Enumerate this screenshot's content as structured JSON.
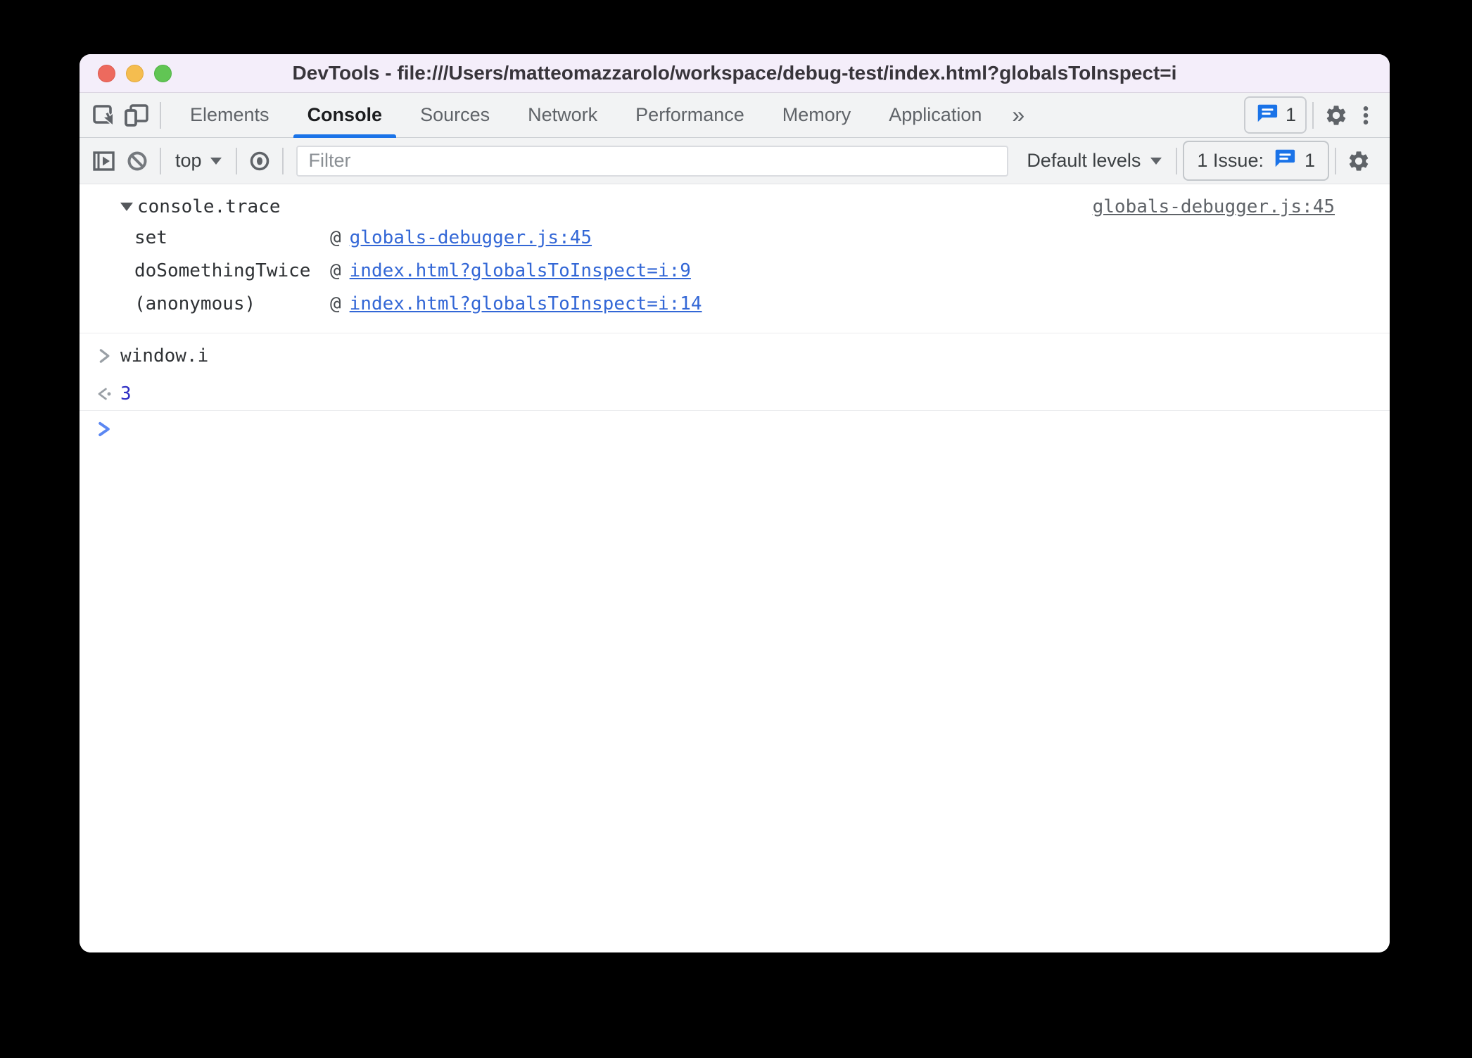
{
  "window_title": "DevTools - file:///Users/matteomazzarolo/workspace/debug-test/index.html?globalsToInspect=i",
  "tabbar": {
    "tabs": [
      "Elements",
      "Console",
      "Sources",
      "Network",
      "Performance",
      "Memory",
      "Application"
    ],
    "active_tab": "Console",
    "more_tabs": "»",
    "messages_count": "1"
  },
  "toolbar": {
    "context": "top",
    "filter_placeholder": "Filter",
    "filter_value": "",
    "levels": "Default levels",
    "issues_text": "1 Issue:",
    "issues_count": "1"
  },
  "console": {
    "trace": {
      "label": "console.trace",
      "source_link": "globals-debugger.js:45",
      "frames": [
        {
          "name": "set",
          "sep": "@",
          "link": "globals-debugger.js:45"
        },
        {
          "name": "doSomethingTwice",
          "sep": "@",
          "link": "index.html?globalsToInspect=i:9"
        },
        {
          "name": "(anonymous)",
          "sep": "@",
          "link": "index.html?globalsToInspect=i:14"
        }
      ]
    },
    "command": "window.i",
    "result": "3"
  },
  "colors": {
    "accent_blue": "#1a73e8",
    "link_blue": "#3367d6",
    "result_blue": "#2f2fc4",
    "titlebar_bg": "#f4eefa",
    "toolbar_bg": "#f2f3f4",
    "icon_gray": "#5f6368",
    "traffic_red": "#ed6a5e",
    "traffic_yellow": "#f5bd4f",
    "traffic_green": "#61c554"
  }
}
